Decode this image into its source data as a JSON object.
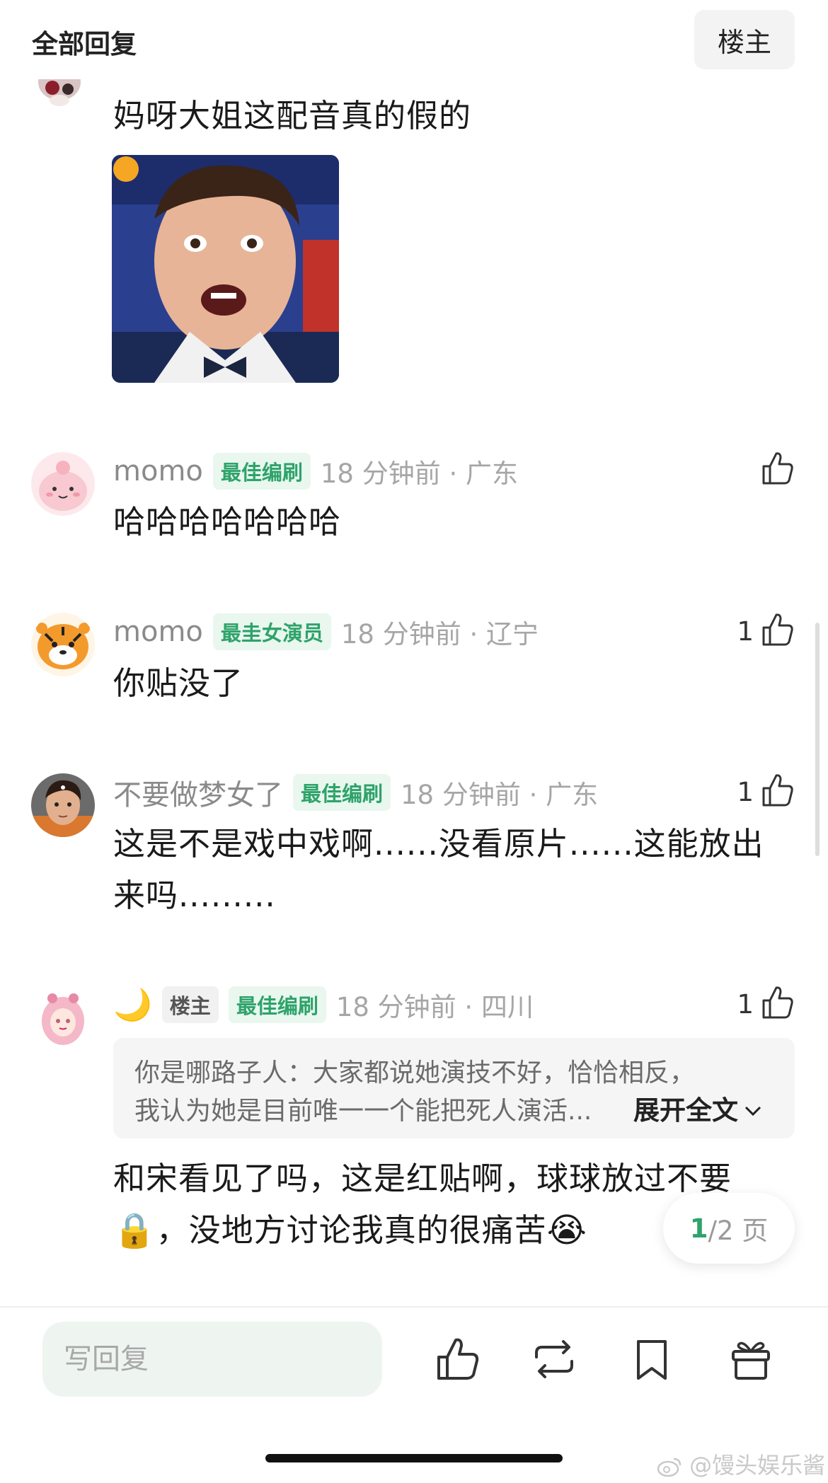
{
  "header": {
    "title": "全部回复",
    "op_filter": "楼主"
  },
  "comments": [
    {
      "text": "妈呀大姐这配音真的假的"
    },
    {
      "username": "momo",
      "badge": "最佳编刷",
      "time_loc": "18 分钟前 · 广东",
      "likes": "",
      "text": "哈哈哈哈哈哈哈"
    },
    {
      "username": "momo",
      "badge": "最圭女演员",
      "time_loc": "18 分钟前 · 辽宁",
      "likes": "1",
      "text": "你贴没了"
    },
    {
      "username": "不要做梦女了",
      "badge": "最佳编刷",
      "time_loc": "18 分钟前 · 广东",
      "likes": "1",
      "text_line1": "这是不是戏中戏啊......没看原片......这能放出",
      "text_line2": "来吗........."
    },
    {
      "username": "🌙",
      "op_badge": "楼主",
      "badge": "最佳编刷",
      "time_loc": "18 分钟前 · 四川",
      "likes": "1",
      "quote_line1": "你是哪路子人：大家都说她演技不好，恰恰相反，",
      "quote_line2": "我认为她是目前唯一一个能把死人演活...",
      "expand": "展开全文",
      "text_line1": "和宋看见了吗，这是红贴啊，球球放过不要",
      "text_line2_emoji_lock": "🔒",
      "text_line2": "，没地方讨论我真的很痛苦",
      "text_line2_emoji_cry": "😭"
    }
  ],
  "pager": {
    "current": "1",
    "total": "/2 页"
  },
  "bottom_bar": {
    "reply_placeholder": "写回复"
  },
  "watermark": "@馒头娱乐酱",
  "colors": {
    "accent_green": "#2ea36a",
    "badge_bg": "#e9f7ef",
    "reply_bg": "#eef5f1"
  },
  "icons": [
    "thumbs-up-icon",
    "repost-icon",
    "bookmark-icon",
    "gift-icon",
    "chevron-down-icon",
    "weibo-logo-icon"
  ]
}
